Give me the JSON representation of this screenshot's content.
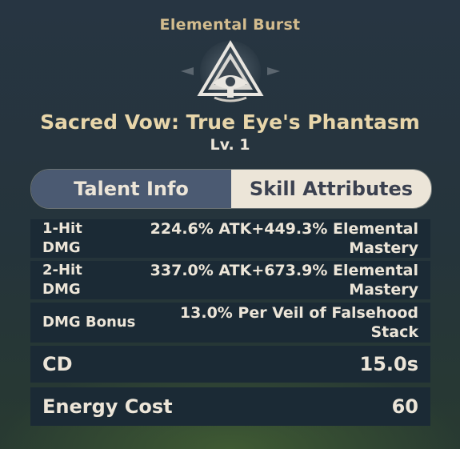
{
  "header": {
    "label": "Elemental Burst"
  },
  "skill": {
    "icon": "eye-triangle-emblem-icon",
    "name": "Sacred Vow: True Eye's Phantasm",
    "level": "Lv. 1"
  },
  "tabs": [
    {
      "label": "Talent Info",
      "active": false
    },
    {
      "label": "Skill Attributes",
      "active": true
    }
  ],
  "attributes": [
    {
      "label_line1": "1-Hit",
      "label_line2": "DMG",
      "value_line1": "224.6% ATK+449.3% Elemental",
      "value_line2": "Mastery"
    },
    {
      "label_line1": "2-Hit",
      "label_line2": "DMG",
      "value_line1": "337.0% ATK+673.9% Elemental",
      "value_line2": "Mastery"
    },
    {
      "label_line1": "DMG Bonus",
      "value_line1": "13.0% Per Veil of Falsehood",
      "value_line2": "Stack"
    },
    {
      "label_line1": "CD",
      "value_line1": "15.0s"
    },
    {
      "label_line1": "Energy Cost",
      "value_line1": "60"
    }
  ],
  "colors": {
    "header_gold": "#d3bc8e",
    "name_gold": "#e8d6aa",
    "tab_inactive": "#4b5a72",
    "tab_active": "#ece5d8",
    "row_bg": "#1b2a35",
    "text": "#ece5d8"
  }
}
